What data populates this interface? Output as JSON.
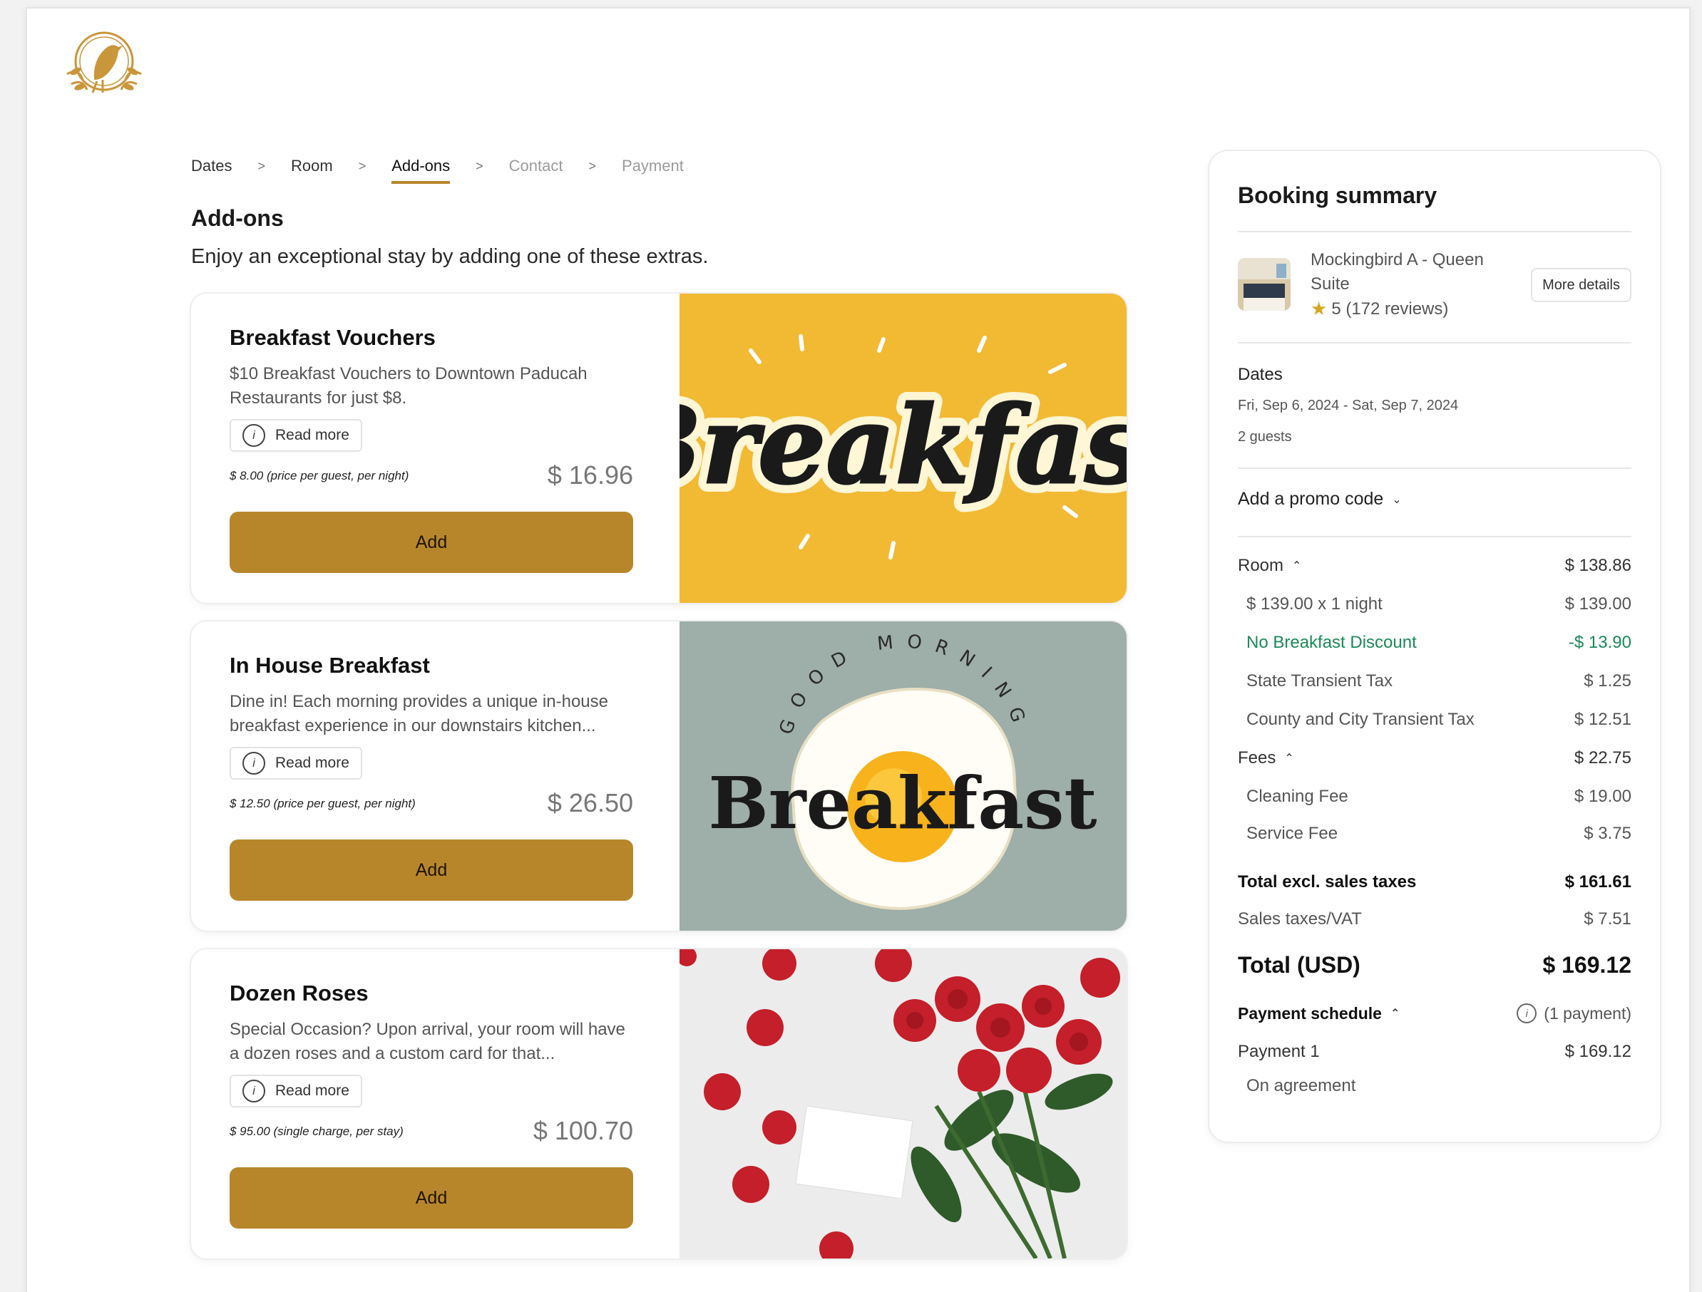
{
  "breadcrumb": {
    "dates": "Dates",
    "room": "Room",
    "addons": "Add-ons",
    "contact": "Contact",
    "payment": "Payment",
    "separator": ">"
  },
  "page": {
    "title": "Add-ons",
    "subtitle": "Enjoy an exceptional stay by adding one of these extras."
  },
  "addons": [
    {
      "title": "Breakfast Vouchers",
      "description": "$10 Breakfast Vouchers to Downtown Paducah Restaurants for just $8.",
      "read_more": "Read more",
      "unit_price": "$ 8.00 (price per guest, per night)",
      "total_price": "$ 16.96",
      "add_label": "Add",
      "image_text": "Breakfast"
    },
    {
      "title": "In House Breakfast",
      "description": "Dine in! Each morning provides a unique in-house breakfast experience in our downstairs kitchen...",
      "read_more": "Read more",
      "unit_price": "$ 12.50 (price per guest, per night)",
      "total_price": "$ 26.50",
      "add_label": "Add",
      "image_text": "Breakfast",
      "image_arc_text": "GOOD MORNING"
    },
    {
      "title": "Dozen Roses",
      "description": "Special Occasion? Upon arrival, your room will have a dozen roses and a custom card for that...",
      "read_more": "Read more",
      "unit_price": "$ 95.00 (single charge, per stay)",
      "total_price": "$ 100.70",
      "add_label": "Add"
    }
  ],
  "summary": {
    "title": "Booking summary",
    "room_name": "Mockingbird A - Queen Suite",
    "rating": "5 (172 reviews)",
    "more_details": "More details",
    "dates_label": "Dates",
    "dates_value": "Fri, Sep 6, 2024 - Sat, Sep 7, 2024",
    "guests": "2 guests",
    "promo": "Add a promo code",
    "room": {
      "label": "Room",
      "value": "$ 138.86"
    },
    "room_rate": {
      "label": "$ 139.00 x 1 night",
      "value": "$ 139.00"
    },
    "discount": {
      "label": "No Breakfast Discount",
      "value": "-$ 13.90"
    },
    "state_tax": {
      "label": "State Transient Tax",
      "value": "$ 1.25"
    },
    "county_tax": {
      "label": "County and City Transient Tax",
      "value": "$ 12.51"
    },
    "fees": {
      "label": "Fees",
      "value": "$ 22.75"
    },
    "cleaning_fee": {
      "label": "Cleaning Fee",
      "value": "$ 19.00"
    },
    "service_fee": {
      "label": "Service Fee",
      "value": "$ 3.75"
    },
    "total_excl": {
      "label": "Total excl. sales taxes",
      "value": "$ 161.61"
    },
    "sales_tax": {
      "label": "Sales taxes/VAT",
      "value": "$ 7.51"
    },
    "total": {
      "label": "Total (USD)",
      "value": "$ 169.12"
    },
    "payment_schedule": {
      "label": "Payment schedule",
      "value": "(1 payment)"
    },
    "payment_1": {
      "label": "Payment 1",
      "value": "$ 169.12"
    },
    "on_agreement": "On agreement"
  },
  "colors": {
    "accent": "#b8862a",
    "discount_green": "#1a8a5a",
    "card1_bg": "#f2b933",
    "card2_bg": "#9eaea8"
  },
  "icons": {
    "logo": "mockingbird-logo-icon",
    "info": "info-icon",
    "star": "star-icon",
    "chevron": "chevron-icon"
  }
}
